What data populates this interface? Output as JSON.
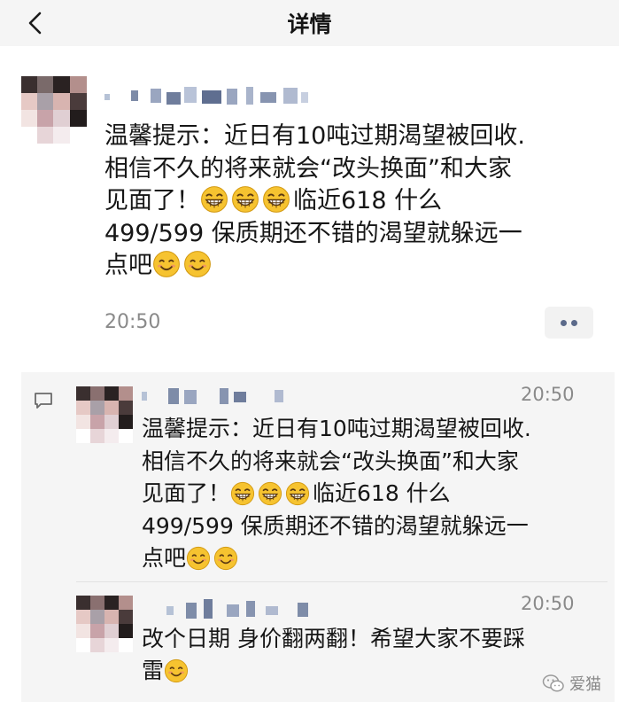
{
  "nav": {
    "title": "详情",
    "back_icon": "chevron-left-icon"
  },
  "post": {
    "text": "温馨提示：近日有10吨过期渴望被回收.\n相信不久的将来就会“改头换面”和大家\n见面了！",
    "text_tail": "临近618   什么\n499/599  保质期还不错的渴望就躲远一\n点吧",
    "time": "20:50",
    "emoji_grin": "grinning-face-icon",
    "emoji_smile": "smiling-face-icon"
  },
  "comments": {
    "icon": "comment-icon",
    "items": [
      {
        "time": "20:50",
        "text": "温馨提示：近日有10吨过期渴望被回收.\n相信不久的将来就会“改头换面”和大家\n见面了！",
        "text_tail": "临近618   什么\n499/599  保质期还不错的渴望就躲远一\n点吧"
      },
      {
        "time": "20:50",
        "text": "改个日期 身价翻两翻！希望大家不要踩\n雷"
      }
    ]
  },
  "watermark": {
    "text": "爱猫",
    "icon": "wechat-icon"
  },
  "colors": {
    "nav_bg": "#f5f5f5",
    "comment_bg": "#f5f5f5",
    "time": "#8a8a8a",
    "emoji": "#f6c330"
  }
}
